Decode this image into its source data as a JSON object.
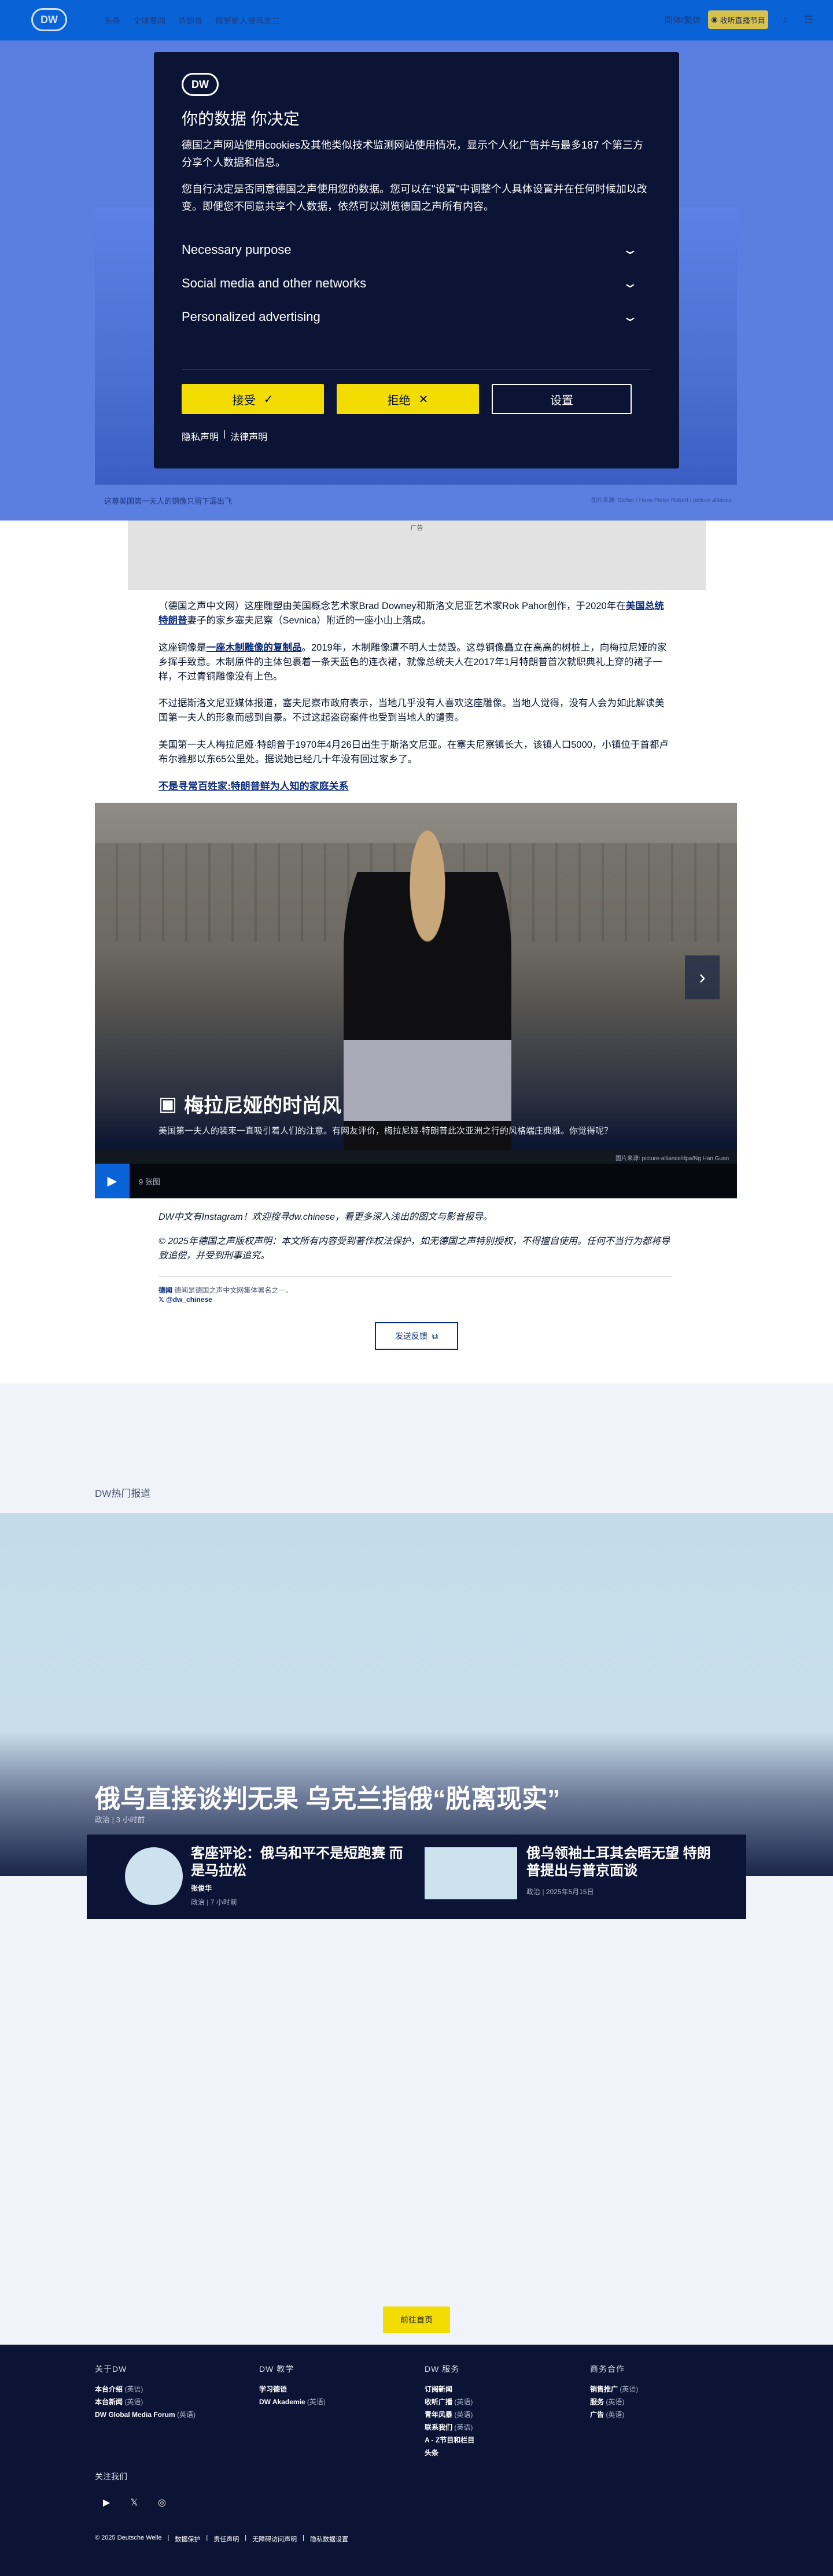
{
  "header": {
    "logo": "DW",
    "nav": [
      "头条",
      "全球要闻",
      "特朗普",
      "俄罗斯入侵乌克兰"
    ],
    "lang": "简体/繁体",
    "live_label": "收听直播节目"
  },
  "hero": {
    "caption": "这尊美国第一夫人的铜像只留下漏出飞",
    "credit": "图片来源: Stefan / Hans Pieter Robert / picture alliance"
  },
  "consent": {
    "logo": "DW",
    "title": "你的数据 你决定",
    "p1": "德国之声网站使用cookies及其他类似技术监测网站使用情况，显示个人化广告并与最多187 个第三方分享个人数据和信息。",
    "p2": "您自行决定是否同意德国之声使用您的数据。您可以在\"设置\"中调整个人具体设置并在任何时候加以改变。即便您不同意共享个人数据，依然可以浏览德国之声所有内容。",
    "purposes": [
      "Necessary purpose",
      "Social media and other networks",
      "Personalized advertising"
    ],
    "accept": "接受",
    "reject": "拒绝",
    "settings": "设置",
    "privacy": "隐私声明",
    "legal": "法律声明"
  },
  "ad": {
    "label": "广告"
  },
  "article": {
    "p1_a": "（德国之声中文网）这座雕塑由美国概念艺术家Brad Downey和斯洛文尼亚艺术家Rok Pahor创作，于2020年在",
    "p1_link": "美国总统特朗普",
    "p1_b": "妻子的家乡塞夫尼察（Sevnica）附近的一座小山上落成。",
    "p2_a": "这座铜像是",
    "p2_link": "一座木制雕像的复制品",
    "p2_b": "。2019年，木制雕像遭不明人士焚毁。这尊铜像矗立在高高的树桩上，向梅拉尼娅的家乡挥手致意。木制原件的主体包裹着一条天蓝色的连衣裙，就像总统夫人在2017年1月特朗普首次就职典礼上穿的裙子一样，不过青铜雕像没有上色。",
    "p3": "不过据斯洛文尼亚媒体报道，塞夫尼察市政府表示，当地几乎没有人喜欢这座雕像。当地人觉得，没有人会为如此解读美国第一夫人的形象而感到自豪。不过这起盗窃案件也受到当地人的谴责。",
    "p4": "美国第一夫人梅拉尼娅·特朗普于1970年4月26日出生于斯洛文尼亚。在塞夫尼察镇长大，该镇人口5000，小镇位于首都卢布尔雅那以东65公里处。据说她已经几十年没有回过家乡了。",
    "link_heading": "不是寻常百姓家:特朗普鲜为人知的家庭关系"
  },
  "gallery": {
    "title": "梅拉尼娅的时尚风",
    "desc": "美国第一夫人的装束一直吸引着人们的注意。有网友评价，梅拉尼娅·特朗普此次亚洲之行的风格端庄典雅。你觉得呢？",
    "credit": "图片来源: picture-alliance/dpa/Ng Han Guan",
    "count": "9 张图"
  },
  "footer_note": {
    "instagram": "DW中文有Instagram！欢迎搜寻dw.chinese，看更多深入浅出的图文与影音报导。",
    "copyright": "© 2025年德国之声版权声明：本文所有内容受到著作权法保护，如无德国之声特别授权，不得擅自使用。任何不当行为都将导致追偿，并受到刑事追究。",
    "author_label": "德闻",
    "author_desc": "德闻是德国之声中文网集体署名之一。",
    "x_handle": "@dw_chinese",
    "feedback": "发送反馈"
  },
  "hot": {
    "label": "DW热门报道",
    "main_title": "俄乌直接谈判无果 乌克兰指俄“脱离现实”",
    "main_meta": "政治 | 3 小时前",
    "card1_title": "客座评论：俄乌和平不是短跑赛 而是马拉松",
    "card1_author": "张俊华",
    "card1_meta": "政治 | 7 小时前",
    "card2_title": "俄乌领袖土耳其会晤无望 特朗普提出与普京面谈",
    "card2_meta": "政治 | 2025年5月15日",
    "back_home": "前往首页"
  },
  "footer": {
    "col1_head": "关于DW",
    "col1_items": [
      [
        "本台介绍",
        "(英语)"
      ],
      [
        "本台新闻",
        "(英语)"
      ],
      [
        "DW Global Media Forum",
        "(英语)"
      ]
    ],
    "col2_head": "DW 教学",
    "col2_items": [
      [
        "学习德语",
        ""
      ],
      [
        "DW Akademie",
        "(英语)"
      ]
    ],
    "col3_head": "DW 服务",
    "col3_items": [
      [
        "订阅新闻",
        ""
      ],
      [
        "收听广播",
        "(英语)"
      ],
      [
        "青年风暴",
        "(英语)"
      ],
      [
        "联系我们",
        "(英语)"
      ],
      [
        "A - Z节目和栏目",
        ""
      ],
      [
        "头条",
        ""
      ]
    ],
    "col4_head": "商务合作",
    "col4_items": [
      [
        "销售推广",
        "(英语)"
      ],
      [
        "服务",
        "(英语)"
      ],
      [
        "广告",
        "(英语)"
      ]
    ],
    "follow": "关注我们",
    "bottom": [
      "© 2025 Deutsche Welle",
      "数据保护",
      "责任声明",
      "无障碍访问声明",
      "隐私数据设置"
    ]
  },
  "colors": {
    "dw_blue": "#0a63d6",
    "navy": "#0b1434",
    "accent_yellow": "#f2dc02"
  },
  "icons": [
    "search-icon",
    "menu-icon",
    "check-icon",
    "close-icon",
    "chevron-down-icon",
    "chevron-right-icon",
    "play-icon",
    "gallery-icon",
    "x-icon",
    "youtube-icon",
    "instagram-icon",
    "copy-icon"
  ]
}
